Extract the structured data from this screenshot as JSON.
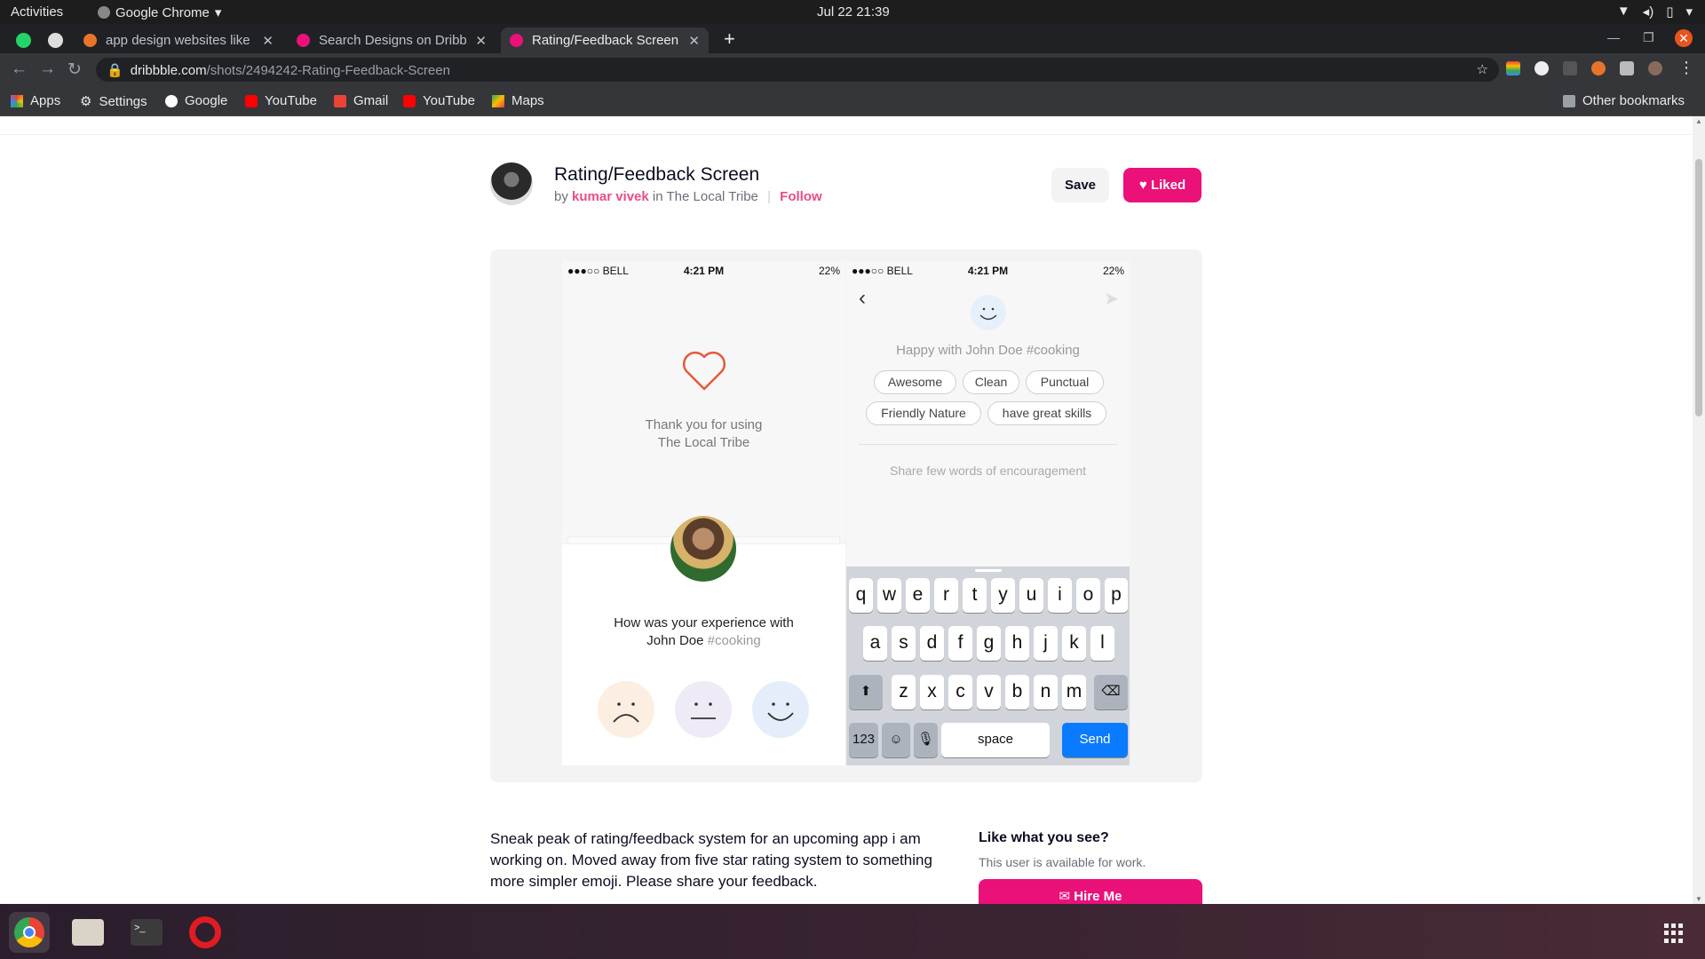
{
  "system": {
    "activities": "Activities",
    "app_name": "Google Chrome",
    "clock": "Jul 22  21:39"
  },
  "tabs": [
    {
      "title": "app design websites like d",
      "color": "#e8742c"
    },
    {
      "title": "Search Designs on Dribbble",
      "color": "#ea1179"
    },
    {
      "title": "Rating/Feedback Screen by",
      "color": "#ea1179"
    }
  ],
  "url": {
    "host": "dribbble.com",
    "path": "/shots/2494242-Rating-Feedback-Screen"
  },
  "bookmarks": [
    "Apps",
    "Settings",
    "Google",
    "YouTube",
    "Gmail",
    "YouTube",
    "Maps"
  ],
  "other_bookmarks": "Other bookmarks",
  "shot": {
    "title": "Rating/Feedback Screen",
    "by": "by",
    "author": "kumar vivek",
    "in": "in",
    "team": "The Local Tribe",
    "follow": "Follow",
    "save": "Save",
    "liked": "Liked"
  },
  "phone1": {
    "carrier": "●●●○○ BELL",
    "time": "4:21 PM",
    "battery": "22%",
    "thanks_line1": "Thank you for using",
    "thanks_line2": "The Local Tribe",
    "question_line1": "How was your experience with",
    "question_name": "John Doe",
    "question_tag": "#cooking"
  },
  "phone2": {
    "carrier": "●●●○○ BELL",
    "time": "4:21 PM",
    "battery": "22%",
    "happy": "Happy with John Doe #cooking",
    "chips": [
      "Awesome",
      "Clean",
      "Punctual",
      "Friendly Nature",
      "have great skills"
    ],
    "encourage": "Share few words of encouragement",
    "row1": [
      "q",
      "w",
      "e",
      "r",
      "t",
      "y",
      "u",
      "i",
      "o",
      "p"
    ],
    "row2": [
      "a",
      "s",
      "d",
      "f",
      "g",
      "h",
      "j",
      "k",
      "l"
    ],
    "row3": [
      "z",
      "x",
      "c",
      "v",
      "b",
      "n",
      "m"
    ],
    "numkey": "123",
    "space": "space",
    "send": "Send"
  },
  "description": "Sneak peak of rating/feedback system for an upcoming app i am working on. Moved away from five star rating system to something more simpler emoji. Please share your feedback.",
  "sidebar": {
    "like_heading": "Like what you see?",
    "available": "This user is available for work.",
    "hire": "Hire Me"
  },
  "colors": {
    "brand_pink": "#ea1179",
    "ios_blue": "#0a7aff"
  }
}
